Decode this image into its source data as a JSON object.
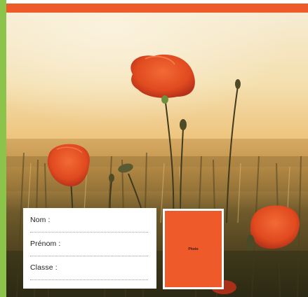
{
  "form": {
    "nom_label": "Nom :",
    "prenom_label": "Prénom :",
    "classe_label": "Classe :"
  },
  "photo_box": {
    "label": "Photo"
  },
  "colors": {
    "accent": "#ef5a2a",
    "left_strip": "#8cc34a",
    "card": "#ffffff"
  }
}
